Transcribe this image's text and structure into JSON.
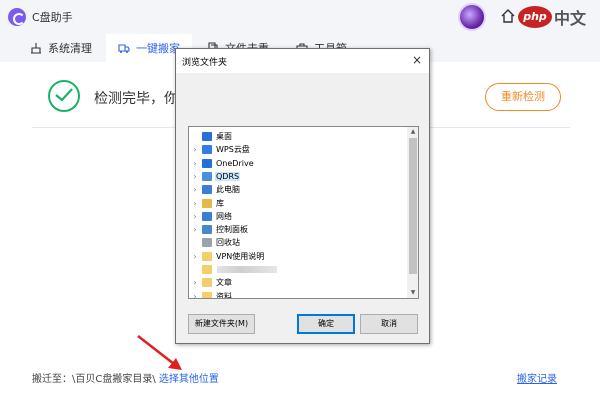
{
  "app": {
    "title": "C盘助手"
  },
  "header": {
    "watermark_logo": "php",
    "watermark_text": "中文网"
  },
  "tabs": [
    {
      "label": "系统清理",
      "icon": "broom-icon",
      "active": false
    },
    {
      "label": "一键搬家",
      "icon": "truck-icon",
      "active": true
    },
    {
      "label": "文件去重",
      "icon": "files-icon",
      "active": false
    },
    {
      "label": "工具箱",
      "icon": "toolbox-icon",
      "active": false
    }
  ],
  "main": {
    "status_text": "检测完毕，你",
    "rescan_label": "重新检测",
    "path_prefix": "搬迁至：\\百贝C盘搬家目录\\",
    "choose_location": "选择其他位置",
    "record_link": "搬家记录"
  },
  "dialog": {
    "title": "浏览文件夹",
    "close_label": "×",
    "tree": [
      {
        "label": "桌面",
        "icon": "desktop-icon",
        "color": "#2a6fd6",
        "expand": false,
        "level": 0,
        "selected": false
      },
      {
        "label": "WPS云盘",
        "icon": "cloud-icon",
        "color": "#2f7ee8",
        "expand": true,
        "level": 1,
        "selected": false
      },
      {
        "label": "OneDrive",
        "icon": "onedrive-icon",
        "color": "#1e73d8",
        "expand": true,
        "level": 1,
        "selected": false
      },
      {
        "label": "QDRS",
        "icon": "user-folder-icon",
        "color": "#4a90d9",
        "expand": true,
        "level": 1,
        "selected": true
      },
      {
        "label": "此电脑",
        "icon": "computer-icon",
        "color": "#3b7fd4",
        "expand": true,
        "level": 1,
        "selected": false
      },
      {
        "label": "库",
        "icon": "library-icon",
        "color": "#e4b945",
        "expand": true,
        "level": 1,
        "selected": false
      },
      {
        "label": "网络",
        "icon": "network-icon",
        "color": "#3b7fd4",
        "expand": true,
        "level": 1,
        "selected": false
      },
      {
        "label": "控制面板",
        "icon": "control-panel-icon",
        "color": "#4a86c8",
        "expand": true,
        "level": 1,
        "selected": false
      },
      {
        "label": "回收站",
        "icon": "recycle-bin-icon",
        "color": "#9aa4ad",
        "expand": false,
        "level": 1,
        "selected": false
      },
      {
        "label": "VPN使用说明",
        "icon": "folder-icon",
        "color": "#f3cf6b",
        "expand": true,
        "level": 1,
        "selected": false
      },
      {
        "label": "",
        "icon": "folder-icon",
        "color": "#f3cf6b",
        "expand": false,
        "level": 1,
        "selected": false,
        "blurred": true
      },
      {
        "label": "文章",
        "icon": "folder-icon",
        "color": "#f3cf6b",
        "expand": true,
        "level": 1,
        "selected": false
      },
      {
        "label": "资料",
        "icon": "folder-icon",
        "color": "#f3cf6b",
        "expand": true,
        "level": 1,
        "selected": false
      }
    ],
    "new_folder_label": "新建文件夹(M)",
    "ok_label": "确定",
    "cancel_label": "取消"
  },
  "colors": {
    "accent": "#2b64e8",
    "success": "#18b26b",
    "warning": "#f08a2a",
    "arrow": "#e02020"
  }
}
